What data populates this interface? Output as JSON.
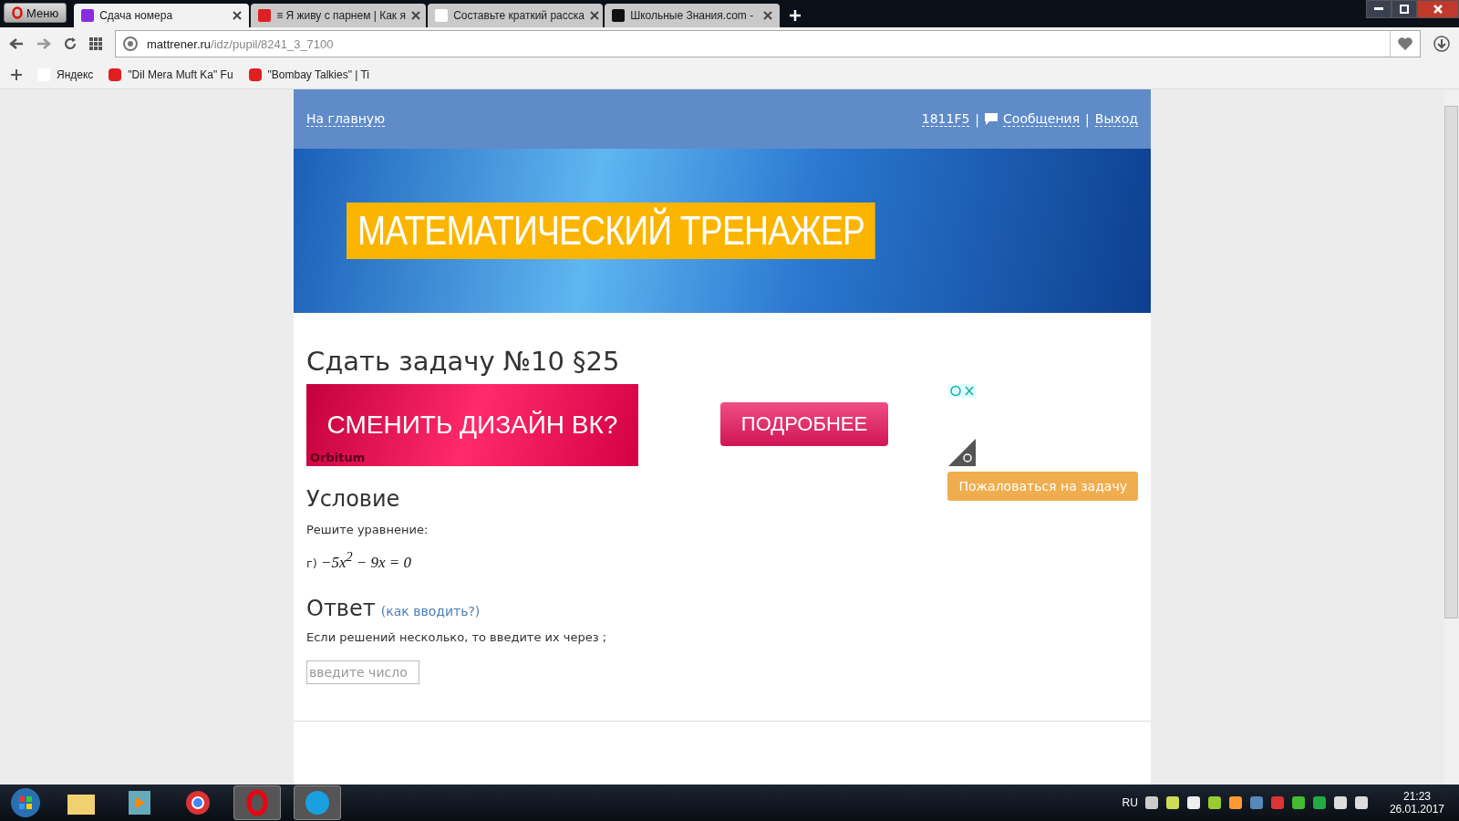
{
  "browser": {
    "menu_label": "Меню",
    "tabs": [
      {
        "title": "Сдача номера",
        "selected": true,
        "kind": "site"
      },
      {
        "title": "≡ Я живу с парнем | Как я",
        "selected": false,
        "kind": "video"
      },
      {
        "title": "Составьте краткий расска",
        "selected": false,
        "kind": "yandex"
      },
      {
        "title": "Школьные Знания.com - ",
        "selected": false,
        "kind": "znania"
      }
    ],
    "address": {
      "domain": "mattrener.ru",
      "path": "/idz/pupil/8241_3_7100"
    },
    "bookmarks": [
      {
        "label": "Яндекс",
        "kind": "yandex"
      },
      {
        "label": "\"Dil Mera Muft Ka\" Fu",
        "kind": "video"
      },
      {
        "label": "\"Bombay Talkies\" | Ti",
        "kind": "video"
      }
    ]
  },
  "header": {
    "home_link": "На главную",
    "user_id": "1811F5",
    "separator_1": "|",
    "messages_link": "Сообщения",
    "separator_2": "|",
    "logout_link": "Выход"
  },
  "banner": {
    "title": "МАТЕМАТИЧЕСКИЙ ТРЕНАЖЕР"
  },
  "task": {
    "title": "Сдать задачу №10 §25",
    "ads": {
      "left_text": "СМЕНИТЬ ДИЗАЙН ВК?",
      "left_brand": "Orbitum",
      "right_button": "ПОДРОБНЕЕ"
    },
    "report_button": "Пожаловаться на задачу",
    "condition_heading": "Условие",
    "condition_text": "Решите уравнение:",
    "equation_label": "г)",
    "equation": "−5x$^{2}$ − 9x = 0",
    "answer_heading": "Ответ",
    "answer_help_link": "(как вводить?)",
    "answer_hint": "Если решений несколько, то введите их через ;",
    "answer_field": {
      "placeholder": "введите число"
    }
  },
  "taskbar": {
    "language": "RU",
    "time": "21:23",
    "date": "26.01.2017"
  }
}
